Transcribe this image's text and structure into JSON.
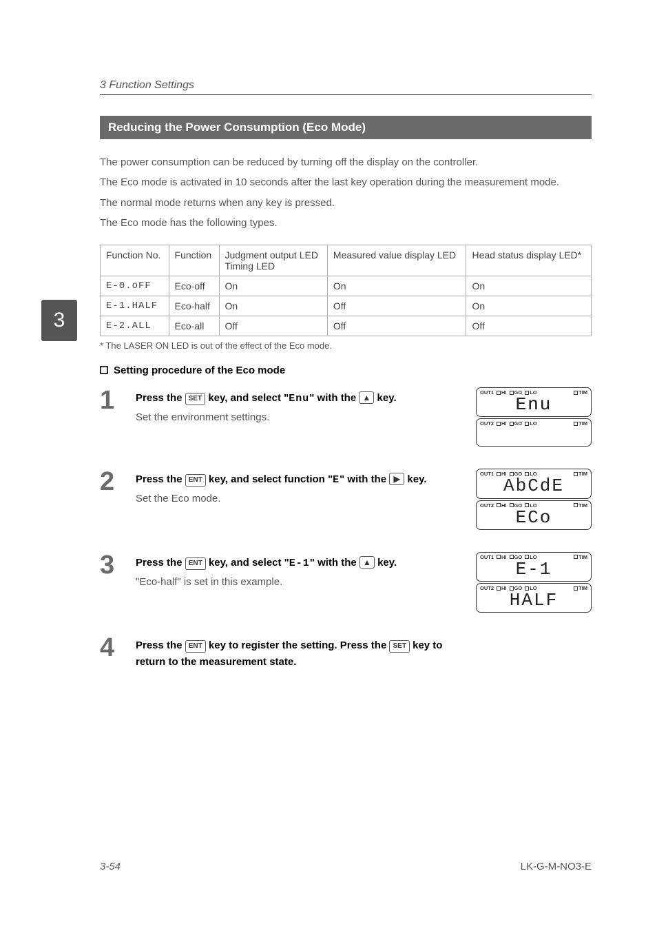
{
  "chapter": "3  Function Settings",
  "side_tab": "3",
  "section_title": "Reducing the Power Consumption (Eco Mode)",
  "intro": {
    "p1": "The power consumption can be reduced by turning off the display on the controller.",
    "p2": "The Eco mode is activated in 10 seconds after the last key operation during the measurement mode.",
    "p3": "The normal mode returns when any key is pressed.",
    "p4": "The Eco mode has the following types."
  },
  "table": {
    "headers": {
      "c1": "Function No.",
      "c2": "Function",
      "c3": "Judgment output LED\nTiming LED",
      "c4": "Measured value display LED",
      "c5": "Head status display LED*"
    },
    "rows": [
      {
        "c1": "E-0.oFF",
        "c2": "Eco-off",
        "c3": "On",
        "c4": "On",
        "c5": "On"
      },
      {
        "c1": "E-1.HALF",
        "c2": "Eco-half",
        "c3": "On",
        "c4": "Off",
        "c5": "On"
      },
      {
        "c1": "E-2.ALL",
        "c2": "Eco-all",
        "c3": "Off",
        "c4": "Off",
        "c5": "Off"
      }
    ],
    "footnote": "* The LASER ON LED is out of the effect of the Eco mode."
  },
  "subheading": "Setting procedure of the Eco mode",
  "steps": [
    {
      "num": "1",
      "title_parts": {
        "pre": "Press the ",
        "key1": "SET",
        "mid": " key, and select \"",
        "code": "Enu",
        "mid2": "\" with the ",
        "key2": "▲",
        "post": " key."
      },
      "desc": "Set the environment settings.",
      "lcd": [
        {
          "out": "OUT1",
          "seg": "Enu",
          "blinky": true
        },
        {
          "out": "OUT2",
          "seg": "",
          "blinky": false
        }
      ]
    },
    {
      "num": "2",
      "title_parts": {
        "pre": "Press the ",
        "key1": "ENT",
        "mid": " key, and select function \"",
        "code": "E",
        "mid2": "\" with the ",
        "key2": "▶",
        "post": " key."
      },
      "desc": "Set the Eco mode.",
      "lcd": [
        {
          "out": "OUT1",
          "seg": "AbCdE"
        },
        {
          "out": "OUT2",
          "seg": "ECo"
        }
      ]
    },
    {
      "num": "3",
      "title_parts": {
        "pre": "Press the ",
        "key1": "ENT",
        "mid": " key, and select \"",
        "code": "E-1",
        "mid2": "\" with the ",
        "key2": "▲",
        "post": " key."
      },
      "desc": "\"Eco-half\" is set in this example.",
      "lcd": [
        {
          "out": "OUT1",
          "seg": "E-1"
        },
        {
          "out": "OUT2",
          "seg": "HALF"
        }
      ]
    },
    {
      "num": "4",
      "title_parts": {
        "pre": "Press the ",
        "key1": "ENT",
        "mid": " key to register the setting. Press the ",
        "key2txt": "SET",
        "post": " key to return to the measurement state."
      },
      "desc": "",
      "lcd": []
    }
  ],
  "lcd_labels": {
    "out1": "OUT1",
    "out2": "OUT2",
    "hi": "HI",
    "go": "GO",
    "lo": "LO",
    "tim": "TIM"
  },
  "footer": {
    "page": "3-54",
    "doc": "LK-G-M-NO3-E"
  }
}
